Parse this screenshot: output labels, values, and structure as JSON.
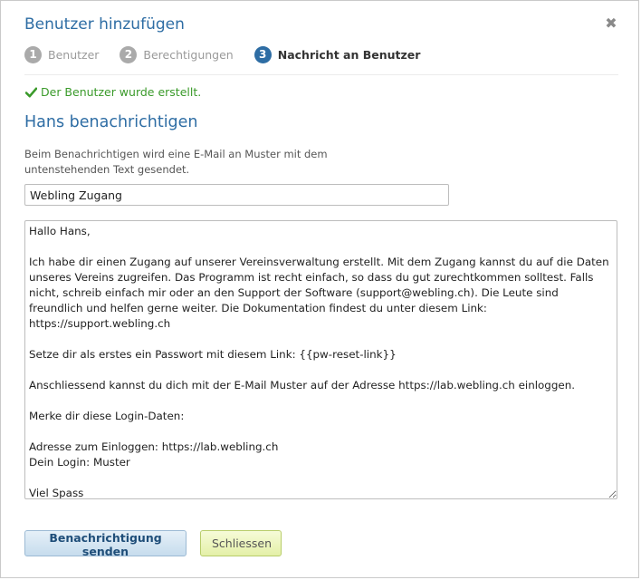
{
  "dialog": {
    "title": "Benutzer hinzufügen",
    "close_icon": "close-icon"
  },
  "steps": [
    {
      "number": "1",
      "label": "Benutzer",
      "active": false
    },
    {
      "number": "2",
      "label": "Berechtigungen",
      "active": false
    },
    {
      "number": "3",
      "label": "Nachricht an Benutzer",
      "active": true
    }
  ],
  "status": {
    "icon": "checkmark-icon",
    "text": "Der Benutzer wurde erstellt."
  },
  "section": {
    "heading": "Hans benachrichtigen",
    "description": "Beim Benachrichtigen wird eine E-Mail an Muster mit dem untenstehenden Text gesendet."
  },
  "form": {
    "subject_value": "Webling Zugang",
    "message_value": "Hallo Hans,\n\nIch habe dir einen Zugang auf unserer Vereinsverwaltung erstellt. Mit dem Zugang kannst du auf die Daten unseres Vereins zugreifen. Das Programm ist recht einfach, so dass du gut zurechtkommen solltest. Falls nicht, schreib einfach mir oder an den Support der Software (support@webling.ch). Die Leute sind freundlich und helfen gerne weiter. Die Dokumentation findest du unter diesem Link: https://support.webling.ch\n\nSetze dir als erstes ein Passwort mit diesem Link: {{pw-reset-link}}\n\nAnschliessend kannst du dich mit der E-Mail Muster auf der Adresse https://lab.webling.ch einloggen.\n\nMerke dir diese Login-Daten:\n\nAdresse zum Einloggen: https://lab.webling.ch\nDein Login: Muster\n\nViel Spass"
  },
  "buttons": {
    "send_label": "Benachrichtigung senden",
    "close_label": "Schliessen"
  },
  "colors": {
    "accent": "#2e6da4",
    "success": "#3a9a2a",
    "step_inactive": "#aaaaaa"
  }
}
